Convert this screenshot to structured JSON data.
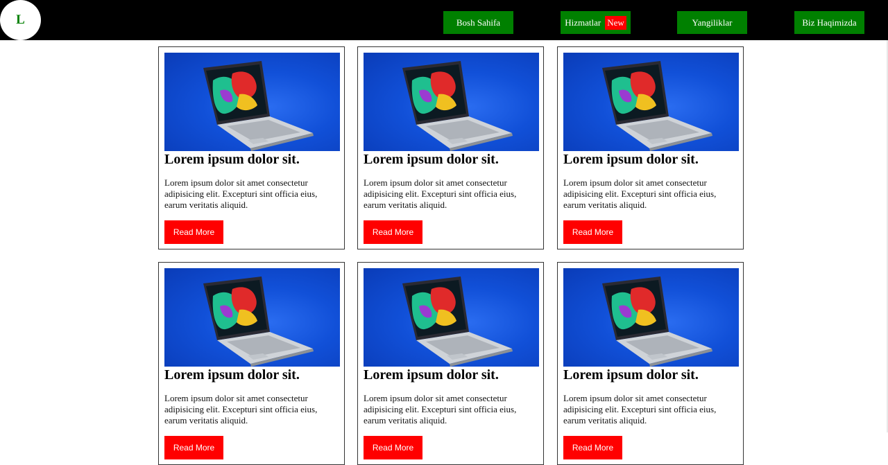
{
  "logo": {
    "text": "L"
  },
  "nav": {
    "items": [
      {
        "label": "Bosh Sahifa"
      },
      {
        "label": "Hizmatlar",
        "badge": "New"
      },
      {
        "label": "Yangiliklar"
      },
      {
        "label": "Biz Haqimizda"
      }
    ]
  },
  "cards": [
    {
      "title": "Lorem ipsum dolor sit.",
      "text": "Lorem ipsum dolor sit amet consectetur adipisicing elit. Excepturi sint officia eius, earum veritatis aliquid.",
      "button": "Read More"
    },
    {
      "title": "Lorem ipsum dolor sit.",
      "text": "Lorem ipsum dolor sit amet consectetur adipisicing elit. Excepturi sint officia eius, earum veritatis aliquid.",
      "button": "Read More"
    },
    {
      "title": "Lorem ipsum dolor sit.",
      "text": "Lorem ipsum dolor sit amet consectetur adipisicing elit. Excepturi sint officia eius, earum veritatis aliquid.",
      "button": "Read More"
    },
    {
      "title": "Lorem ipsum dolor sit.",
      "text": "Lorem ipsum dolor sit amet consectetur adipisicing elit. Excepturi sint officia eius, earum veritatis aliquid.",
      "button": "Read More"
    },
    {
      "title": "Lorem ipsum dolor sit.",
      "text": "Lorem ipsum dolor sit amet consectetur adipisicing elit. Excepturi sint officia eius, earum veritatis aliquid.",
      "button": "Read More"
    },
    {
      "title": "Lorem ipsum dolor sit.",
      "text": "Lorem ipsum dolor sit amet consectetur adipisicing elit. Excepturi sint officia eius, earum veritatis aliquid.",
      "button": "Read More"
    }
  ],
  "colors": {
    "navbar": "#000000",
    "nav_button": "#008000",
    "badge": "#ff0000",
    "read_more": "#ff0000",
    "logo_text": "#008000"
  },
  "icons": {
    "card_image": "laptop-photo"
  }
}
